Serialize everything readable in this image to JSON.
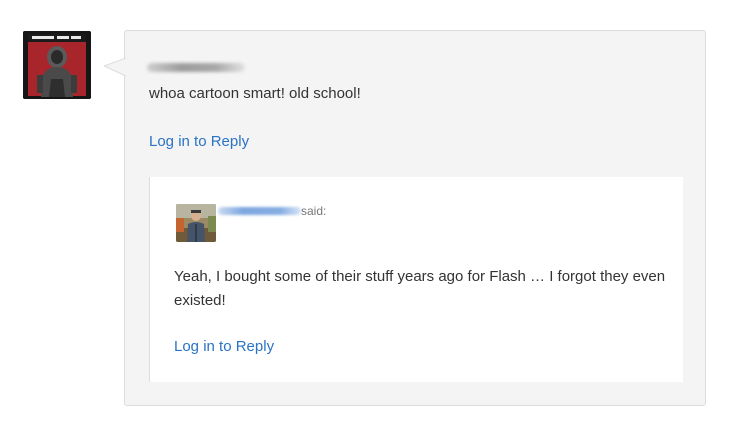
{
  "comment": {
    "avatar_icon": "avatar-icon",
    "text": "whoa cartoon smart! old school!",
    "reply_label": "Log in to Reply",
    "reply": {
      "said_label": "said:",
      "text": "Yeah, I bought some of their stuff years ago for Flash … I forgot they even existed!",
      "reply_label": "Log in to Reply"
    }
  },
  "colors": {
    "link": "#2a73c5",
    "comment_background": "#f4f4f4",
    "border": "#dcdcdc",
    "text": "#333333"
  }
}
